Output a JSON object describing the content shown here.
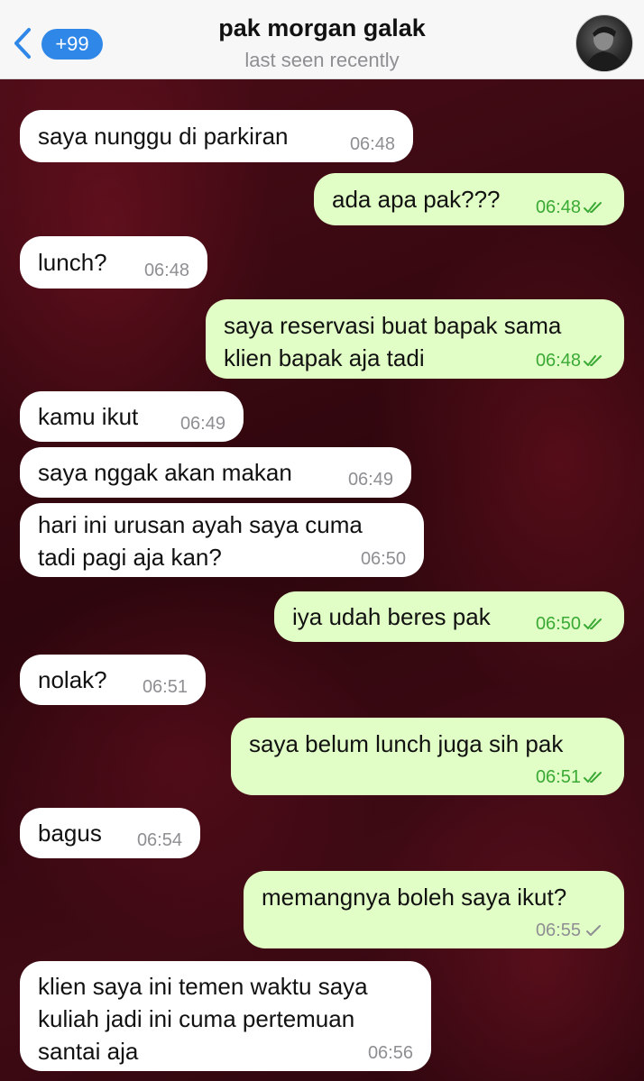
{
  "header": {
    "back_icon": "chevron-left-icon",
    "unread_badge": "+99",
    "title": "pak morgan galak",
    "status": "last seen recently",
    "avatar": "contact-avatar"
  },
  "colors": {
    "incoming_bubble": "#ffffff",
    "outgoing_bubble": "#e1fec6",
    "accent_blue": "#2f87e8",
    "read_green": "#3aaa35"
  },
  "messages": [
    {
      "dir": "in",
      "text": "saya nunggu di parkiran",
      "time": "06:48"
    },
    {
      "dir": "out",
      "text": "ada apa pak???",
      "time": "06:48",
      "status": "read"
    },
    {
      "dir": "in",
      "text": "lunch?",
      "time": "06:48"
    },
    {
      "dir": "out",
      "text": "saya reservasi buat bapak sama\nklien bapak aja tadi",
      "time": "06:48",
      "status": "read"
    },
    {
      "dir": "in",
      "text": "kamu ikut",
      "time": "06:49"
    },
    {
      "dir": "in",
      "text": "saya nggak akan makan",
      "time": "06:49"
    },
    {
      "dir": "in",
      "text": "hari ini urusan ayah saya cuma\ntadi pagi aja kan?",
      "time": "06:50"
    },
    {
      "dir": "out",
      "text": "iya udah beres pak",
      "time": "06:50",
      "status": "read"
    },
    {
      "dir": "in",
      "text": "nolak?",
      "time": "06:51"
    },
    {
      "dir": "out",
      "text": "saya belum lunch juga sih pak",
      "time": "06:51",
      "status": "read"
    },
    {
      "dir": "in",
      "text": "bagus",
      "time": "06:54"
    },
    {
      "dir": "out",
      "text": "memangnya boleh saya ikut?",
      "time": "06:55",
      "status": "sent"
    },
    {
      "dir": "in",
      "text": "klien saya ini temen waktu saya\nkuliah jadi ini cuma pertemuan\nsantai aja",
      "time": "06:56"
    }
  ]
}
